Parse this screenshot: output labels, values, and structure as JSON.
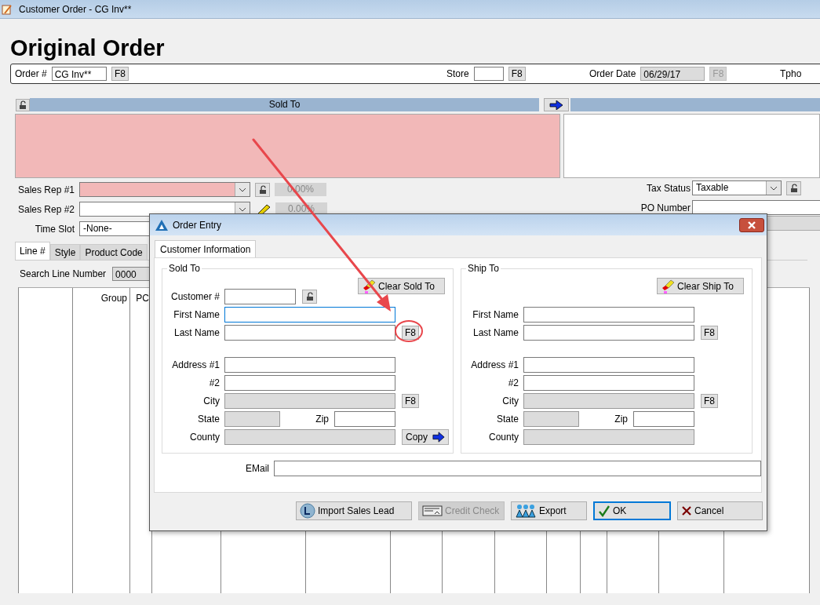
{
  "window": {
    "title": "Customer Order - CG Inv**"
  },
  "heading": "Original Order",
  "order_bar": [
    {
      "label": "Order #",
      "value": "CG Inv**",
      "button": "F8"
    },
    {
      "label": "Store",
      "button": "F8"
    },
    {
      "label": "Order Date",
      "value": "06/29/17",
      "button": "F8",
      "disabled": true
    },
    {
      "label": "Tpho"
    }
  ],
  "sold_to_header": "Sold To",
  "sales_reps": [
    {
      "label": "Sales Rep #1",
      "required": true,
      "kind": "lock",
      "reading": "0.00%"
    },
    {
      "label": "Sales Rep #2",
      "required": false,
      "kind": "edit",
      "reading": "0.00%"
    }
  ],
  "time_slot": {
    "label": "Time Slot",
    "value": "-None-"
  },
  "tax_status": {
    "label": "Tax Status",
    "value": "Taxable"
  },
  "po_number": {
    "label": "PO Number"
  },
  "tabs": [
    {
      "label": "Line #",
      "selected": true
    },
    {
      "label": "Style",
      "selected": false
    },
    {
      "label": "Product Code",
      "selected": false
    }
  ],
  "search_line": {
    "label": "Search Line Number",
    "value": "0000"
  },
  "grid_columns": [
    "Group",
    "PC"
  ],
  "dialog": {
    "title": "Order Entry",
    "tab": "Customer Information",
    "groups": [
      {
        "legend": "Sold To",
        "clear_button": "Clear Sold To",
        "name_fields": [
          {
            "kind": "customer",
            "label": "Customer #",
            "focused": false,
            "disabled": false
          },
          {
            "kind": "text",
            "label": "First Name",
            "focused": true,
            "disabled": false
          },
          {
            "kind": "lookup",
            "label": "Last Name",
            "button": "F8",
            "highlighted": true,
            "focused": false,
            "disabled": false
          }
        ],
        "address_fields": [
          {
            "kind": "text",
            "label": "Address #1",
            "disabled": false
          },
          {
            "kind": "text",
            "label": "#2",
            "disabled": false
          },
          {
            "kind": "lookup",
            "label": "City",
            "button": "F8",
            "highlighted": false,
            "disabled": true
          },
          {
            "kind": "state_zip",
            "label": "State",
            "zip_label": "Zip",
            "disabled": true
          },
          {
            "kind": "copy",
            "label": "County",
            "button": "Copy",
            "disabled": true
          }
        ]
      },
      {
        "legend": "Ship To",
        "clear_button": "Clear Ship To",
        "name_fields": [
          {
            "kind": "text",
            "label": "First Name",
            "focused": false,
            "disabled": false
          },
          {
            "kind": "lookup",
            "label": "Last Name",
            "button": "F8",
            "highlighted": false,
            "focused": false,
            "disabled": false
          }
        ],
        "address_fields": [
          {
            "kind": "text",
            "label": "Address #1",
            "disabled": false
          },
          {
            "kind": "text",
            "label": "#2",
            "disabled": false
          },
          {
            "kind": "lookup",
            "label": "City",
            "button": "F8",
            "highlighted": false,
            "disabled": true
          },
          {
            "kind": "state_zip",
            "label": "State",
            "zip_label": "Zip",
            "disabled": true
          },
          {
            "kind": "text",
            "label": "County",
            "disabled": true
          }
        ]
      }
    ],
    "email_label": "EMail",
    "buttons": [
      {
        "label": "Import Sales Lead",
        "kind": "import",
        "disabled": false,
        "default": false
      },
      {
        "label": "Credit Check",
        "kind": "credit",
        "disabled": true,
        "default": false
      },
      {
        "label": "Export",
        "kind": "export",
        "disabled": false,
        "default": false
      },
      {
        "label": "OK",
        "kind": "ok",
        "disabled": false,
        "default": true
      },
      {
        "label": "Cancel",
        "kind": "cancel",
        "disabled": false,
        "default": false
      }
    ]
  }
}
